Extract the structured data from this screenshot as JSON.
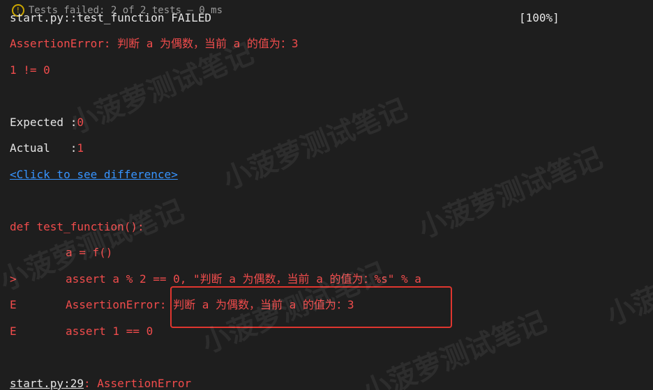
{
  "header": {
    "status_text": "Tests failed: 2 of 2 tests – 0 ms"
  },
  "output": {
    "failed_line": "start.py::test_function FAILED",
    "progress": "[100%]",
    "assertion_error": "AssertionError: 判断 a 为偶数，当前 a 的值为：3",
    "compare_line": "1 != 0",
    "expected_label": "Expected :",
    "expected_value": "0",
    "actual_label": "Actual   :",
    "actual_value": "1",
    "diff_link": "<Click to see difference>",
    "def_line": "def test_function():",
    "code_line_1": "a = f()",
    "marker_gt": ">",
    "code_line_2": "assert a % 2 == 0, \"判断 a 为偶数，当前 a 的值为：%s\" % a",
    "marker_e1": "E",
    "error_prefix": "AssertionError: ",
    "error_message": "判断 a 为偶数，当前 a 的值为：3",
    "marker_e2": "E",
    "assert_line": "assert 1 == 0",
    "location_link": "start.py:29",
    "location_suffix": ": AssertionError"
  },
  "watermark_text": "小菠萝测试笔记",
  "colors": {
    "background": "#1e1e1e",
    "error_red": "#f14c4c",
    "highlight_box": "#e0362f",
    "text": "#e6e6e6"
  }
}
